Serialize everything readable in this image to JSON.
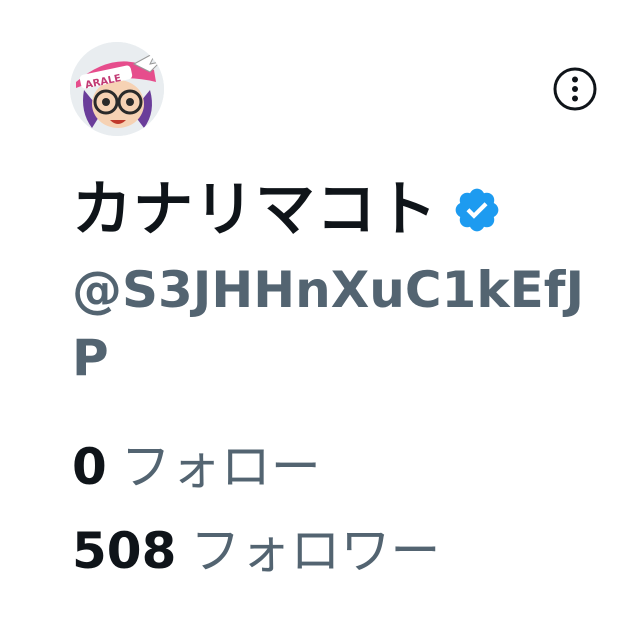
{
  "profile": {
    "display_name": "カナリマコト",
    "username": "@S3JHHnXuC1kEfJP",
    "avatar_icon": "anime-character-avatar",
    "avatar_hat_text": "ARALE",
    "verified": true
  },
  "stats": {
    "following_count": "0",
    "following_label": "フォロー",
    "followers_count": "508",
    "followers_label": "フォロワー"
  },
  "icons": {
    "more": "more-options-icon",
    "verified": "verified-badge-icon"
  },
  "colors": {
    "text_primary": "#0f1419",
    "text_secondary": "#536471",
    "verified_blue": "#1d9bf0"
  }
}
